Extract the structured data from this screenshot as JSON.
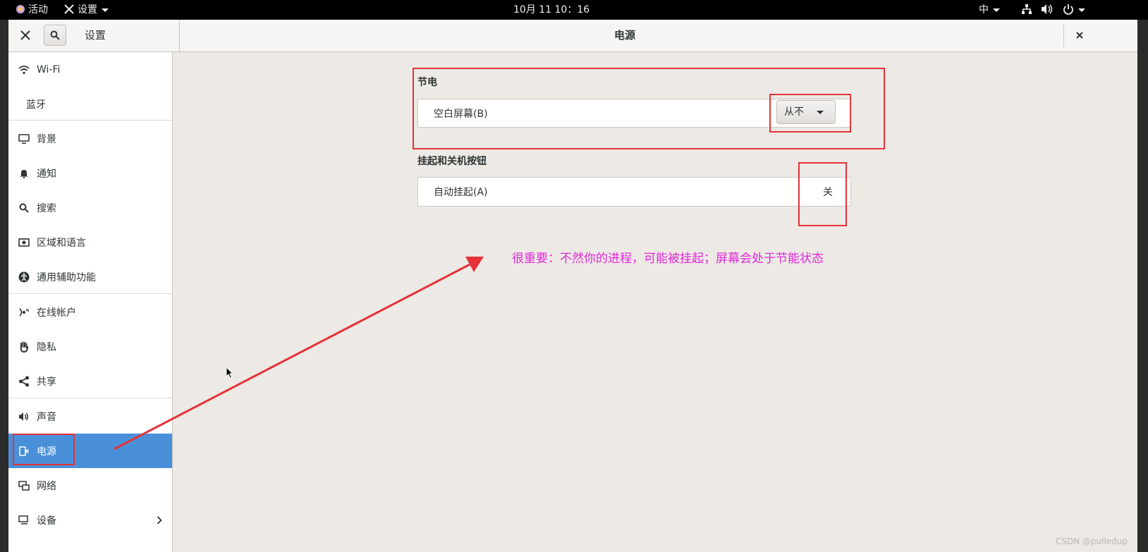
{
  "topbar": {
    "activities": "活动",
    "app_menu": "设置",
    "clock": "10月 11  10：16",
    "input_method": "中"
  },
  "header": {
    "left_title": "设置",
    "title": "电源"
  },
  "sidebar": {
    "items": [
      {
        "label": "Wi-Fi",
        "icon": "wifi-icon"
      },
      {
        "label": "蓝牙",
        "icon": ""
      },
      {
        "label": "背景",
        "icon": "background-icon"
      },
      {
        "label": "通知",
        "icon": "bell-icon"
      },
      {
        "label": "搜索",
        "icon": "search-icon"
      },
      {
        "label": "区域和语言",
        "icon": "region-icon"
      },
      {
        "label": "通用辅助功能",
        "icon": "accessibility-icon"
      },
      {
        "label": "在线帐户",
        "icon": "online-accounts-icon"
      },
      {
        "label": "隐私",
        "icon": "hand-icon"
      },
      {
        "label": "共享",
        "icon": "share-icon"
      },
      {
        "label": "声音",
        "icon": "speaker-icon"
      },
      {
        "label": "电源",
        "icon": "power-plug-icon"
      },
      {
        "label": "网络",
        "icon": "network-icon"
      },
      {
        "label": "设备",
        "icon": "devices-icon"
      }
    ],
    "active_item": "电源"
  },
  "power_saving": {
    "section_title": "节电",
    "blank_screen_label": "空白屏幕(B)",
    "blank_screen_value": "从不"
  },
  "suspend": {
    "section_title": "挂起和关机按钮",
    "auto_suspend_label": "自动挂起(A)",
    "auto_suspend_value": "关"
  },
  "annotation": {
    "note": "很重要：不然你的进程，可能被挂起；屏幕会处于节能状态",
    "note_color": "#e028d8",
    "box_color": "#e53238"
  },
  "watermark": "CSDN @pulledup",
  "colors": {
    "accent": "#4a90d9",
    "window_bg": "#ede9e5",
    "topbar_bg": "#000000"
  }
}
